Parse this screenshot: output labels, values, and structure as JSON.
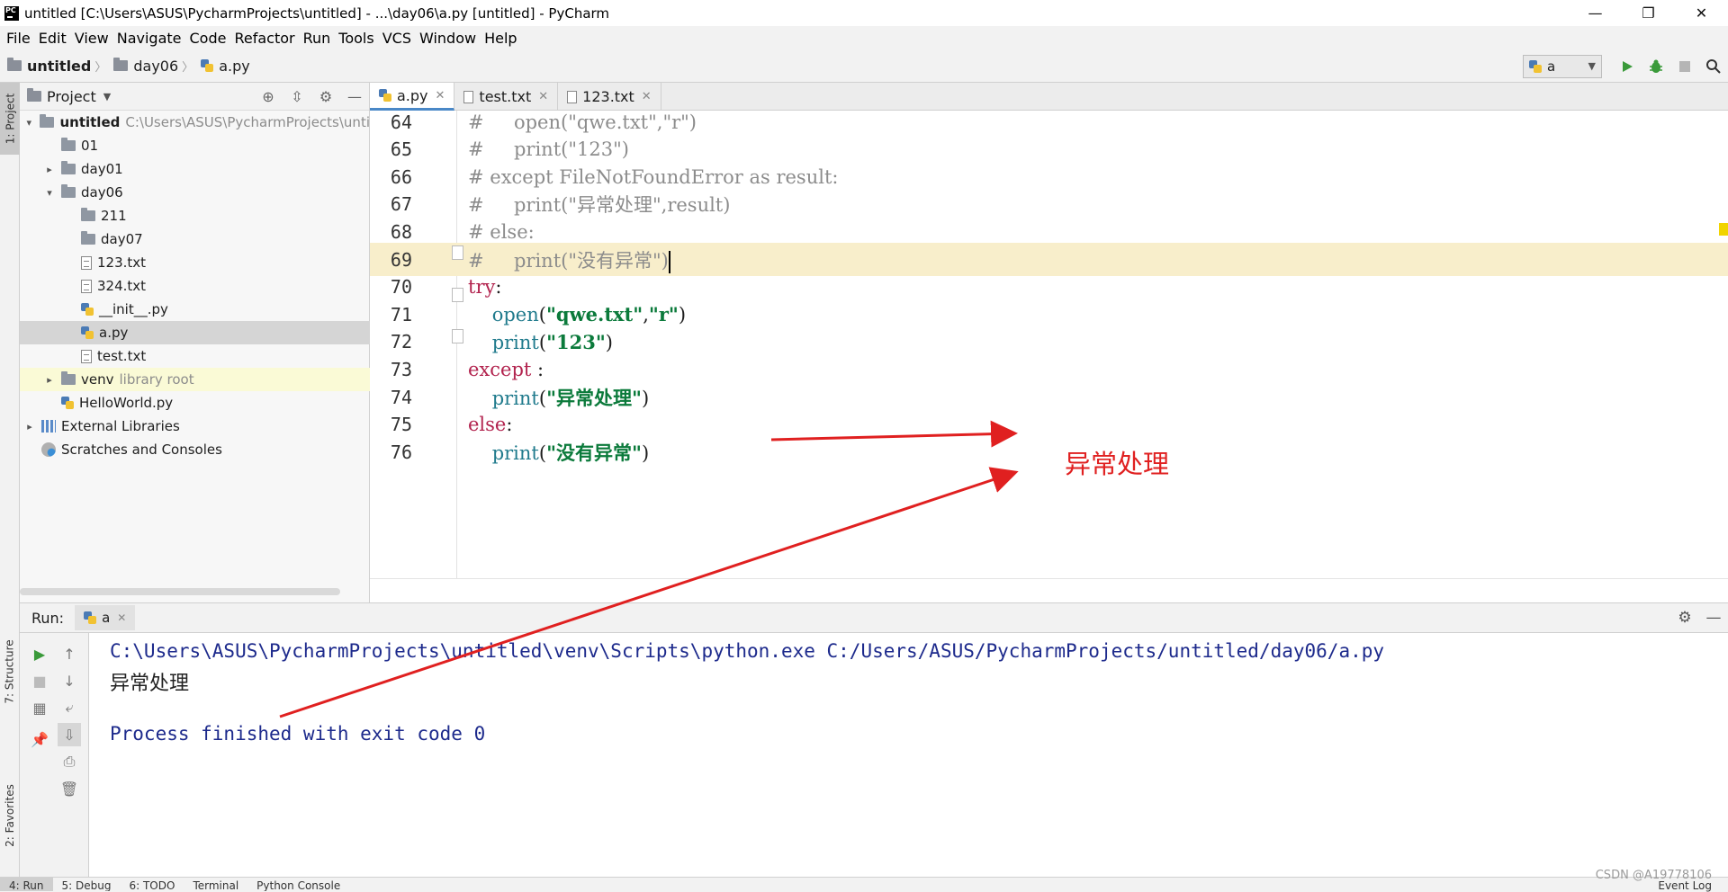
{
  "window": {
    "title": "untitled [C:\\Users\\ASUS\\PycharmProjects\\untitled] - ...\\day06\\a.py [untitled] - PyCharm",
    "logo_text": "PC",
    "minimize": "—",
    "restore": "❐",
    "close": "✕"
  },
  "menu": [
    "File",
    "Edit",
    "View",
    "Navigate",
    "Code",
    "Refactor",
    "Run",
    "Tools",
    "VCS",
    "Window",
    "Help"
  ],
  "breadcrumb": [
    "untitled",
    "day06",
    "a.py"
  ],
  "run_config": {
    "name": "a"
  },
  "left_strip": {
    "project_tab": "1: Project",
    "structure_tab": "7: Structure",
    "favorites_tab": "2: Favorites"
  },
  "project_panel": {
    "title": "Project",
    "tree": [
      {
        "label": "untitled",
        "path": "C:\\Users\\ASUS\\PycharmProjects\\unti",
        "icon": "folder-icon",
        "indent": 0,
        "arrow": "open"
      },
      {
        "label": "01",
        "icon": "folder-icon",
        "indent": 1,
        "arrow": "none"
      },
      {
        "label": "day01",
        "icon": "folder-icon",
        "indent": 1,
        "arrow": "closed"
      },
      {
        "label": "day06",
        "icon": "folder-icon",
        "indent": 1,
        "arrow": "open"
      },
      {
        "label": "211",
        "icon": "folder-icon",
        "indent": 2,
        "arrow": "none"
      },
      {
        "label": "day07",
        "icon": "folder-icon",
        "indent": 2,
        "arrow": "none"
      },
      {
        "label": "123.txt",
        "icon": "text-file-icon",
        "indent": 2,
        "arrow": "none"
      },
      {
        "label": "324.txt",
        "icon": "text-file-icon",
        "indent": 2,
        "arrow": "none"
      },
      {
        "label": "__init__.py",
        "icon": "python-file-icon",
        "indent": 2,
        "arrow": "none"
      },
      {
        "label": "a.py",
        "icon": "python-file-icon",
        "indent": 2,
        "arrow": "none",
        "selected": true
      },
      {
        "label": "test.txt",
        "icon": "text-file-icon",
        "indent": 2,
        "arrow": "none"
      },
      {
        "label": "venv",
        "suffix": "library root",
        "icon": "folder-icon",
        "indent": 1,
        "arrow": "closed",
        "highlight": true
      },
      {
        "label": "HelloWorld.py",
        "icon": "python-file-icon",
        "indent": 1,
        "arrow": "none"
      },
      {
        "label": "External Libraries",
        "icon": "library-icon",
        "indent": 0,
        "arrow": "closed"
      },
      {
        "label": "Scratches and Consoles",
        "icon": "scratch-icon",
        "indent": 0,
        "arrow": "none"
      }
    ]
  },
  "editor": {
    "tabs": [
      {
        "label": "a.py",
        "active": true,
        "icon": "python-file-icon"
      },
      {
        "label": "test.txt",
        "active": false,
        "icon": "text-file-icon"
      },
      {
        "label": "123.txt",
        "active": false,
        "icon": "text-file-icon"
      }
    ],
    "lines": [
      {
        "num": "64",
        "tokens": [
          [
            "c-comment",
            "#     open(\"qwe.txt\",\"r\")"
          ]
        ]
      },
      {
        "num": "65",
        "tokens": [
          [
            "c-comment",
            "#     print(\"123\")"
          ]
        ]
      },
      {
        "num": "66",
        "tokens": [
          [
            "c-comment",
            "# except FileNotFoundError as result:"
          ]
        ]
      },
      {
        "num": "67",
        "tokens": [
          [
            "c-comment",
            "#     print(\"异常处理\",result)"
          ]
        ]
      },
      {
        "num": "68",
        "tokens": [
          [
            "c-comment",
            "# else:"
          ]
        ]
      },
      {
        "num": "69",
        "tokens": [
          [
            "c-comment",
            "#     print(\"没有异常\")"
          ]
        ],
        "current": true
      },
      {
        "num": "70",
        "tokens": [
          [
            "c-kw",
            "try"
          ],
          [
            "c-plain",
            ":"
          ]
        ]
      },
      {
        "num": "71",
        "tokens": [
          [
            "c-plain",
            "    "
          ],
          [
            "c-fn",
            "open"
          ],
          [
            "c-plain",
            "("
          ],
          [
            "c-str",
            "\"qwe.txt\""
          ],
          [
            "c-plain",
            ","
          ],
          [
            "c-str",
            "\"r\""
          ],
          [
            "c-plain",
            ")"
          ]
        ]
      },
      {
        "num": "72",
        "tokens": [
          [
            "c-plain",
            "    "
          ],
          [
            "c-fn",
            "print"
          ],
          [
            "c-plain",
            "("
          ],
          [
            "c-str",
            "\"123\""
          ],
          [
            "c-plain",
            ")"
          ]
        ]
      },
      {
        "num": "73",
        "tokens": [
          [
            "c-kw",
            "except"
          ],
          [
            "c-plain",
            " :"
          ]
        ]
      },
      {
        "num": "74",
        "tokens": [
          [
            "c-plain",
            "    "
          ],
          [
            "c-fn",
            "print"
          ],
          [
            "c-plain",
            "("
          ],
          [
            "c-str",
            "\"异常处理\""
          ],
          [
            "c-plain",
            ")"
          ]
        ]
      },
      {
        "num": "75",
        "tokens": [
          [
            "c-kw",
            "else"
          ],
          [
            "c-plain",
            ":"
          ]
        ]
      },
      {
        "num": "76",
        "tokens": [
          [
            "c-plain",
            "    "
          ],
          [
            "c-fn",
            "print"
          ],
          [
            "c-plain",
            "("
          ],
          [
            "c-str",
            "\"没有异常\""
          ],
          [
            "c-plain",
            ")"
          ]
        ]
      }
    ]
  },
  "annotation": {
    "text": "异常处理",
    "color": "#e02020"
  },
  "run_panel": {
    "label": "Run:",
    "tab": "a",
    "console": [
      {
        "text": "C:\\Users\\ASUS\\PycharmProjects\\untitled\\venv\\Scripts\\python.exe C:/Users/ASUS/PycharmProjects/untitled/day06/a.py",
        "style": "con-blue"
      },
      {
        "text": "异常处理",
        "style": "con-out"
      },
      {
        "text": "Process finished with exit code 0",
        "style": "con-blue"
      }
    ]
  },
  "bottom_tools": [
    "4: Run",
    "5: Debug",
    "6: TODO",
    "Terminal",
    "Python Console"
  ],
  "event_log": "Event Log",
  "watermark": "CSDN @A19778106",
  "colors": {
    "accent": "#4a88c7",
    "current_line": "#f8eecb",
    "keyword": "#b2234e",
    "builtin": "#1f7a8c",
    "string": "#0b7a3b",
    "comment": "#8c8c8c",
    "console_blue": "#1d2a8c",
    "run_green": "#3a9a3a"
  }
}
